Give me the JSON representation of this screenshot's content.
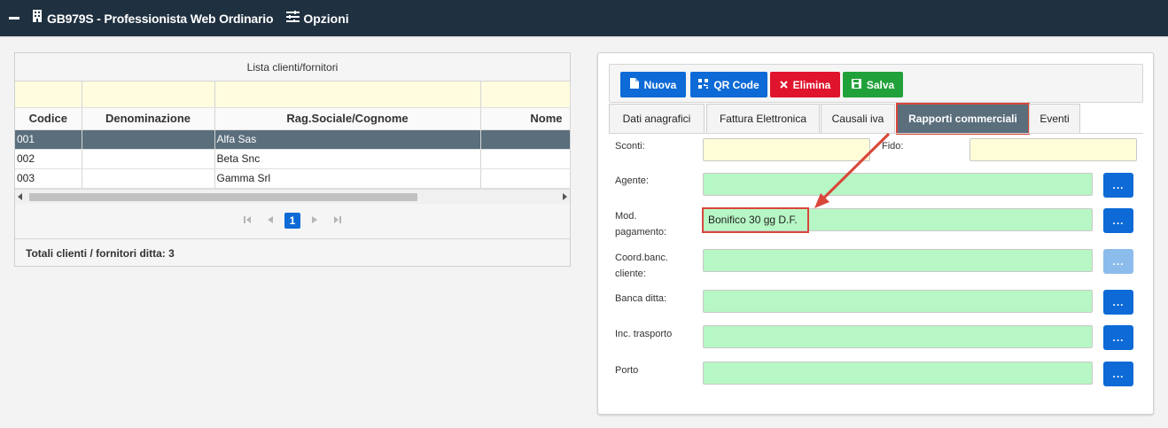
{
  "topbar": {
    "title": "GB979S - Professionista Web Ordinario",
    "options_label": "Opzioni",
    "icons": [
      "minus-icon",
      "building-icon",
      "sliders-icon"
    ]
  },
  "left": {
    "list_title": "Lista clienti/fornitori",
    "columns": [
      "Codice",
      "Denominazione",
      "Rag.Sociale/Cognome",
      "Nome"
    ],
    "rows": [
      {
        "codice": "001",
        "denominazione": "",
        "ragsoc": "Alfa Sas",
        "nome": "",
        "selected": true
      },
      {
        "codice": "002",
        "denominazione": "",
        "ragsoc": "Beta Snc",
        "nome": "",
        "selected": false
      },
      {
        "codice": "003",
        "denominazione": "",
        "ragsoc": "Gamma Srl",
        "nome": "",
        "selected": false
      }
    ],
    "pager": {
      "current_page": "1"
    },
    "totals": "Totali clienti / fornitori ditta: 3"
  },
  "right": {
    "buttons": {
      "nuova": "Nuova",
      "qrcode": "QR Code",
      "elimina": "Elimina",
      "salva": "Salva"
    },
    "tabs": [
      {
        "label": "Dati anagrafici",
        "active": false
      },
      {
        "label": "Fattura Elettronica",
        "active": false
      },
      {
        "label": "Causali iva",
        "active": false
      },
      {
        "label": "Rapporti commerciali",
        "active": true
      },
      {
        "label": "Eventi",
        "active": false
      }
    ],
    "fields": {
      "sconti_label": "Sconti:",
      "sconti_value": "",
      "fido_label": "Fido:",
      "fido_value": "",
      "agente_label": "Agente:",
      "agente_value": "",
      "mod_pag_label_1": "Mod.",
      "mod_pag_label_2": "pagamento:",
      "mod_pag_value": "Bonifico 30 gg D.F.",
      "coord_label_1": "Coord.banc.",
      "coord_label_2": "cliente:",
      "coord_value": "",
      "banca_label": "Banca ditta:",
      "banca_value": "",
      "trasporto_label": "Inc. trasporto",
      "trasporto_value": "",
      "porto_label": "Porto",
      "porto_value": ""
    },
    "lookup_button_label": "..."
  },
  "colors": {
    "topbar_bg": "#1f3040",
    "primary_blue": "#0d6ad6",
    "danger_red": "#e0142c",
    "success_green": "#21a13a",
    "selected_row": "#5a6e7c",
    "filter_yellow": "#fffce0",
    "input_green": "#b7f7c5",
    "annotation_red": "#d9463a"
  }
}
